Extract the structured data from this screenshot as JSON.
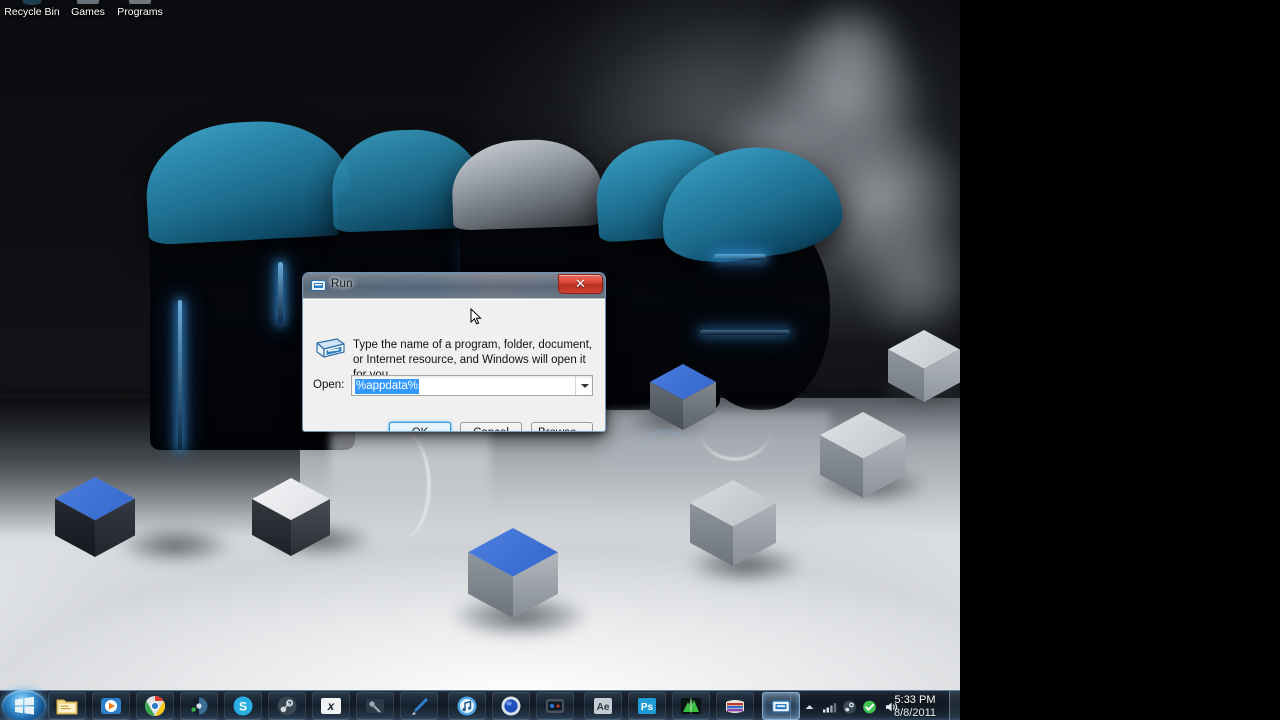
{
  "desktop": {
    "icons": [
      {
        "label": "Recycle Bin",
        "icon": "recycle-bin-icon"
      },
      {
        "label": "Games",
        "icon": "games-folder-icon"
      },
      {
        "label": "Programs",
        "icon": "programs-folder-icon"
      }
    ]
  },
  "wallpaper": {
    "description": "Glossy 3D teal and black letters on a reflective white floor with grey cubes and a smoke plume",
    "accent_color": "#2b87ab",
    "cube_blue": "#2f63c8",
    "floor_color": "#eceef0"
  },
  "dialog": {
    "title": "Run",
    "title_icon": "run-window-icon",
    "close_label": "✕",
    "main_icon": "run-program-icon",
    "description": "Type the name of a program, folder, document, or Internet resource, and Windows will open it for you.",
    "open_label": "Open:",
    "open_value": "%appdata%",
    "open_placeholder": "",
    "buttons": {
      "ok": "OK",
      "cancel": "Cancel",
      "browse": "Browse..."
    }
  },
  "taskbar": {
    "start_label": "Start",
    "items": [
      {
        "name": "windows-explorer",
        "icon": "folder-icon",
        "active": false
      },
      {
        "name": "windows-media-player",
        "icon": "media-player-icon",
        "active": false
      },
      {
        "name": "google-chrome",
        "icon": "chrome-icon",
        "active": false
      },
      {
        "name": "daemon-tools",
        "icon": "disc-icon",
        "active": false
      },
      {
        "name": "skype",
        "icon": "skype-icon",
        "active": false
      },
      {
        "name": "steam",
        "icon": "steam-icon",
        "active": false
      },
      {
        "name": "xfire",
        "icon": "xfire-icon",
        "active": false
      },
      {
        "name": "utility-app",
        "icon": "tool-icon",
        "active": false
      },
      {
        "name": "paint-tool",
        "icon": "brush-icon",
        "active": false
      },
      {
        "name": "itunes",
        "icon": "itunes-icon",
        "active": false
      },
      {
        "name": "blue-sphere-app",
        "icon": "sphere-icon",
        "active": false
      },
      {
        "name": "camera-app",
        "icon": "camera-icon",
        "active": false
      },
      {
        "name": "after-effects",
        "icon": "ae-icon",
        "active": false,
        "badge": "Ae"
      },
      {
        "name": "photoshop",
        "icon": "ps-icon",
        "active": false,
        "badge": "Ps"
      },
      {
        "name": "green-app",
        "icon": "green-burst-icon",
        "active": false
      },
      {
        "name": "winrar",
        "icon": "winrar-icon",
        "active": false
      },
      {
        "name": "run-dialog-window",
        "icon": "run-window-icon",
        "active": true
      }
    ],
    "tray": {
      "show_hidden_icon": "chevron-up-icon",
      "network_icon": "network-bars-icon",
      "steam_icon": "steam-tray-icon",
      "security_icon": "green-shield-icon",
      "volume_icon": "speaker-icon",
      "time": "5:33 PM",
      "date": "8/8/2011",
      "show_desktop": "show-desktop-button"
    }
  }
}
